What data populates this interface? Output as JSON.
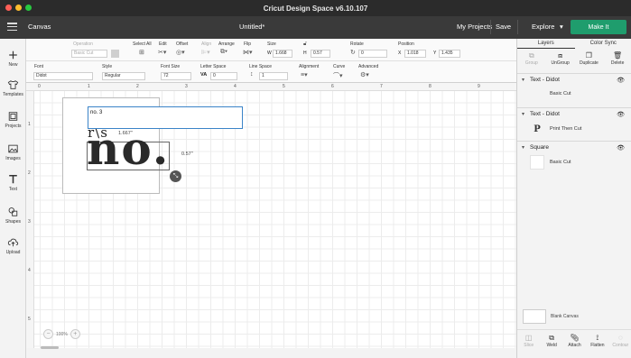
{
  "window": {
    "title": "Cricut Design Space  v6.10.107"
  },
  "appbar": {
    "section": "Canvas",
    "doc_title": "Untitled*",
    "my_projects": "My Projects",
    "save": "Save",
    "explore": "Explore",
    "make_it": "Make It",
    "make_color": "#1f9d6d"
  },
  "sidebar": {
    "items": [
      {
        "label": "New",
        "icon": "plus-icon"
      },
      {
        "label": "Templates",
        "icon": "shirt-icon"
      },
      {
        "label": "Projects",
        "icon": "projects-icon"
      },
      {
        "label": "Images",
        "icon": "images-icon"
      },
      {
        "label": "Text",
        "icon": "text-icon"
      },
      {
        "label": "Shapes",
        "icon": "shapes-icon"
      },
      {
        "label": "Upload",
        "icon": "upload-icon"
      }
    ]
  },
  "toolbar": {
    "operation": {
      "label": "Operation",
      "value": "Basic Cut"
    },
    "select_all": "Select All",
    "edit": "Edit",
    "offset": "Offset",
    "align": "Align",
    "arrange": "Arrange",
    "flip": "Flip",
    "size": {
      "label": "Size",
      "w_label": "W",
      "w": "1.668",
      "h_label": "H",
      "h": "0.57"
    },
    "rotate": {
      "label": "Rotate",
      "value": "0"
    },
    "position": {
      "label": "Position",
      "x_label": "X",
      "x": "1.018",
      "y_label": "Y",
      "y": "1.435"
    }
  },
  "text_toolbar": {
    "font": {
      "label": "Font",
      "value": "Didot"
    },
    "style": {
      "label": "Style",
      "value": "Regular"
    },
    "font_size": {
      "label": "Font Size",
      "value": "72"
    },
    "letter_space": {
      "label": "Letter Space",
      "prefix": "VA",
      "value": "0"
    },
    "line_space": {
      "label": "Line Space",
      "value": "1"
    },
    "alignment": "Alignment",
    "curve": "Curve",
    "advanced": "Advanced"
  },
  "canvas": {
    "ruler_top": [
      "0",
      "1",
      "2",
      "3",
      "4",
      "5",
      "6",
      "7",
      "8",
      "9"
    ],
    "ruler_left": [
      "1",
      "2",
      "3",
      "4",
      "5"
    ],
    "text_input_value": "no. 3",
    "partial_text": "r\\s",
    "main_text": "no.",
    "width_dim": "1.667\"",
    "height_dim": "0.57\"",
    "zoom": "100%"
  },
  "layers_panel": {
    "tabs": [
      "Layers",
      "Color Sync"
    ],
    "actions": [
      {
        "label": "Group",
        "enabled": false
      },
      {
        "label": "UnGroup",
        "enabled": true
      },
      {
        "label": "Duplicate",
        "enabled": true
      },
      {
        "label": "Delete",
        "enabled": true
      }
    ],
    "layers": [
      {
        "title": "Text - Didot",
        "operation": "Basic Cut",
        "thumb": ""
      },
      {
        "title": "Text - Didot",
        "operation": "Print Then Cut",
        "thumb": "P"
      },
      {
        "title": "Square",
        "operation": "Basic Cut",
        "thumb": ""
      }
    ],
    "blank_canvas": "Blank Canvas",
    "bottom_actions": [
      {
        "label": "Slice",
        "enabled": false
      },
      {
        "label": "Weld",
        "enabled": true
      },
      {
        "label": "Attach",
        "enabled": true
      },
      {
        "label": "Flatten",
        "enabled": true
      },
      {
        "label": "Contour",
        "enabled": false
      }
    ]
  }
}
